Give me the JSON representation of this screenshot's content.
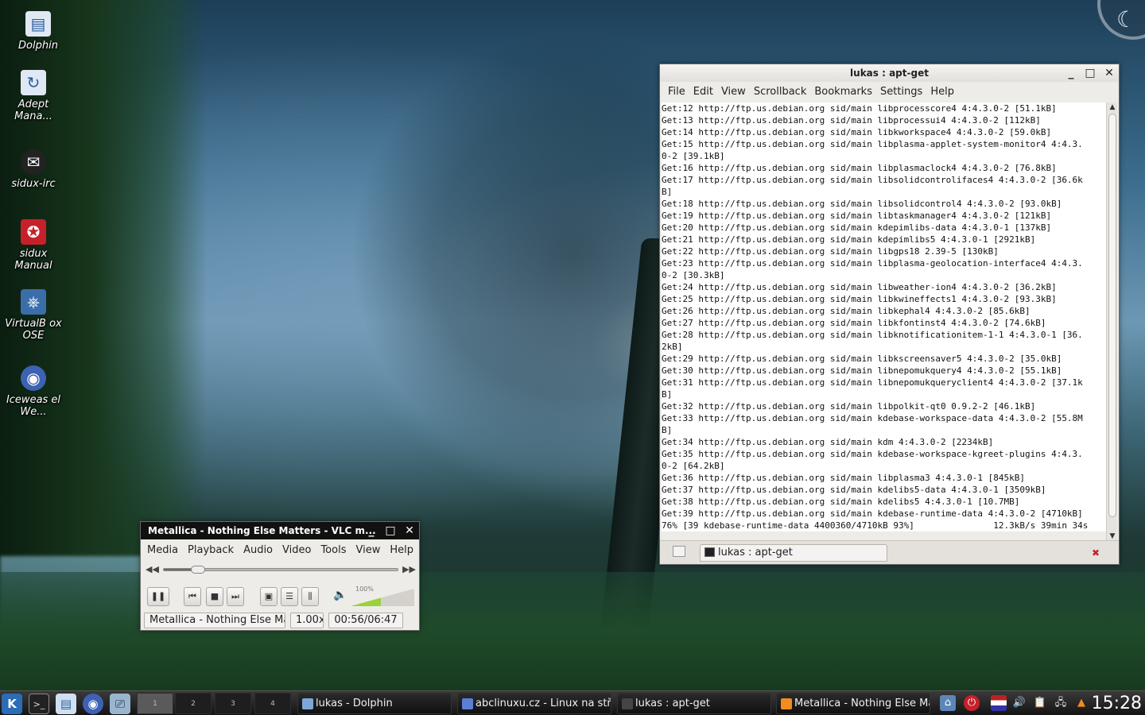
{
  "desktop": {
    "icons": [
      {
        "label": "Dolphin",
        "glyph": "▤"
      },
      {
        "label": "Adept Mana...",
        "glyph": "↻"
      },
      {
        "label": "sidux-irc",
        "glyph": "✉"
      },
      {
        "label": "sidux Manual",
        "glyph": "✪"
      },
      {
        "label": "VirtualB ox OSE",
        "glyph": "⎈"
      },
      {
        "label": "Iceweas el We...",
        "glyph": "◉"
      }
    ]
  },
  "terminal": {
    "title": "lukas : apt-get",
    "menu": [
      "File",
      "Edit",
      "View",
      "Scrollback",
      "Bookmarks",
      "Settings",
      "Help"
    ],
    "lines": [
      "Get:12 http://ftp.us.debian.org sid/main libprocesscore4 4:4.3.0-2 [51.1kB]",
      "Get:13 http://ftp.us.debian.org sid/main libprocessui4 4:4.3.0-2 [112kB]",
      "Get:14 http://ftp.us.debian.org sid/main libkworkspace4 4:4.3.0-2 [59.0kB]",
      "Get:15 http://ftp.us.debian.org sid/main libplasma-applet-system-monitor4 4:4.3.",
      "0-2 [39.1kB]",
      "Get:16 http://ftp.us.debian.org sid/main libplasmaclock4 4:4.3.0-2 [76.8kB]",
      "Get:17 http://ftp.us.debian.org sid/main libsolidcontrolifaces4 4:4.3.0-2 [36.6k",
      "B]",
      "Get:18 http://ftp.us.debian.org sid/main libsolidcontrol4 4:4.3.0-2 [93.0kB]",
      "Get:19 http://ftp.us.debian.org sid/main libtaskmanager4 4:4.3.0-2 [121kB]",
      "Get:20 http://ftp.us.debian.org sid/main kdepimlibs-data 4:4.3.0-1 [137kB]",
      "Get:21 http://ftp.us.debian.org sid/main kdepimlibs5 4:4.3.0-1 [2921kB]",
      "Get:22 http://ftp.us.debian.org sid/main libgps18 2.39-5 [130kB]",
      "Get:23 http://ftp.us.debian.org sid/main libplasma-geolocation-interface4 4:4.3.",
      "0-2 [30.3kB]",
      "Get:24 http://ftp.us.debian.org sid/main libweather-ion4 4:4.3.0-2 [36.2kB]",
      "Get:25 http://ftp.us.debian.org sid/main libkwineffects1 4:4.3.0-2 [93.3kB]",
      "Get:26 http://ftp.us.debian.org sid/main libkephal4 4:4.3.0-2 [85.6kB]",
      "Get:27 http://ftp.us.debian.org sid/main libkfontinst4 4:4.3.0-2 [74.6kB]",
      "Get:28 http://ftp.us.debian.org sid/main libknotificationitem-1-1 4:4.3.0-1 [36.",
      "2kB]",
      "Get:29 http://ftp.us.debian.org sid/main libkscreensaver5 4:4.3.0-2 [35.0kB]",
      "Get:30 http://ftp.us.debian.org sid/main libnepomukquery4 4:4.3.0-2 [55.1kB]",
      "Get:31 http://ftp.us.debian.org sid/main libnepomukqueryclient4 4:4.3.0-2 [37.1k",
      "B]",
      "Get:32 http://ftp.us.debian.org sid/main libpolkit-qt0 0.9.2-2 [46.1kB]",
      "Get:33 http://ftp.us.debian.org sid/main kdebase-workspace-data 4:4.3.0-2 [55.8M",
      "B]",
      "Get:34 http://ftp.us.debian.org sid/main kdm 4:4.3.0-2 [2234kB]",
      "Get:35 http://ftp.us.debian.org sid/main kdebase-workspace-kgreet-plugins 4:4.3.",
      "0-2 [64.2kB]",
      "Get:36 http://ftp.us.debian.org sid/main libplasma3 4:4.3.0-1 [845kB]",
      "Get:37 http://ftp.us.debian.org sid/main kdelibs5-data 4:4.3.0-1 [3509kB]",
      "Get:38 http://ftp.us.debian.org sid/main kdelibs5 4:4.3.0-1 [10.7MB]",
      "Get:39 http://ftp.us.debian.org sid/main kdebase-runtime-data 4:4.3.0-2 [4710kB]",
      "76% [39 kdebase-runtime-data 4400360/4710kB 93%]               12.3kB/s 39min 34s"
    ],
    "tab_label": "lukas : apt-get"
  },
  "vlc": {
    "title": "Metallica - Nothing Else Matters - VLC m...",
    "menu": [
      "Media",
      "Playback",
      "Audio",
      "Video",
      "Tools",
      "View",
      "Help"
    ],
    "seek_fraction": 0.145,
    "volume_percent": "100%",
    "volume_fraction": 0.48,
    "now_playing": "Metallica - Nothing Else Ma",
    "speed": "1.00x",
    "time": "00:56/06:47"
  },
  "taskbar": {
    "pager": [
      "1",
      "2",
      "3",
      "4"
    ],
    "tasks": [
      {
        "label": "lukas - Dolphin",
        "color": "#7da7d9"
      },
      {
        "label": "abclinuxu.cz - Linux na stří",
        "color": "#5b7fd6"
      },
      {
        "label": "lukas : apt-get",
        "color": "#444444"
      },
      {
        "label": "Metallica - Nothing Else Ma",
        "color": "#f28c1e"
      }
    ],
    "clock": "15:28"
  }
}
